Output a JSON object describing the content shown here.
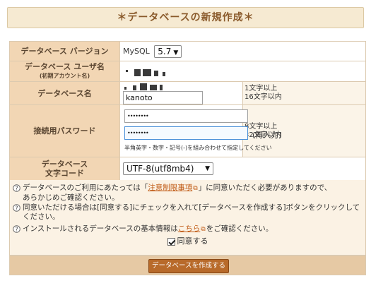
{
  "title": "＊データベースの新規作成＊",
  "form": {
    "version": {
      "label": "データベース バージョン",
      "prefix": "MySQL",
      "selected": "5.7"
    },
    "username": {
      "label": "データベース ユーザ名",
      "sub_label": "(初期アカウント名)"
    },
    "dbname": {
      "label": "データベース名",
      "value": "kanoto",
      "hint_line1": "1文字以上",
      "hint_line2": "16文字以内"
    },
    "password": {
      "label": "接続用パスワード",
      "value1": "••••••••",
      "value2": "••••••••",
      "reenter": "(再入力)",
      "note": "半角英字・数字・記号(-)を組み合わせて指定してください",
      "hint_line1": "8文字以上",
      "hint_line2": "32文字以内"
    },
    "charset": {
      "label_line1": "データベース",
      "label_line2": "文字コード",
      "selected": "UTF-8(utf8mb4)"
    }
  },
  "notice": {
    "line1_a": "データベースのご利用にあたっては「",
    "line1_link": "注意制限事項",
    "line1_b": "」に同意いただく必要がありますので、",
    "line1_c": "あらかじめご確認ください。",
    "line2": "同意いただける場合は[同意する]にチェックを入れて[データベースを作成する]ボタンをクリックしてください。",
    "line3_a": "インストールされるデータベースの基本情報は",
    "line3_link": "こちら",
    "line3_b": "をご確認ください。",
    "agree_label": "同意する"
  },
  "submit_label": "データベースを作成する"
}
